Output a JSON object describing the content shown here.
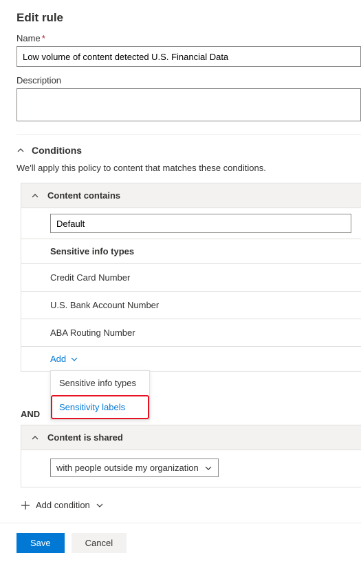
{
  "page": {
    "title": "Edit rule"
  },
  "fields": {
    "name_label": "Name",
    "name_value": "Low volume of content detected U.S. Financial Data",
    "description_label": "Description",
    "description_value": ""
  },
  "conditions": {
    "section_title": "Conditions",
    "description": "We'll apply this policy to content that matches these conditions.",
    "content_contains": {
      "title": "Content contains",
      "default_value": "Default",
      "sit_label": "Sensitive info types",
      "items": [
        "Credit Card Number",
        "U.S. Bank Account Number",
        "ABA Routing Number"
      ],
      "add_label": "Add",
      "dropdown": {
        "option1": "Sensitive info types",
        "option2": "Sensitivity labels"
      }
    },
    "and_label": "AND",
    "content_shared": {
      "title": "Content is shared",
      "selected": "with people outside my organization"
    },
    "add_condition_label": "Add condition"
  },
  "footer": {
    "save": "Save",
    "cancel": "Cancel"
  }
}
